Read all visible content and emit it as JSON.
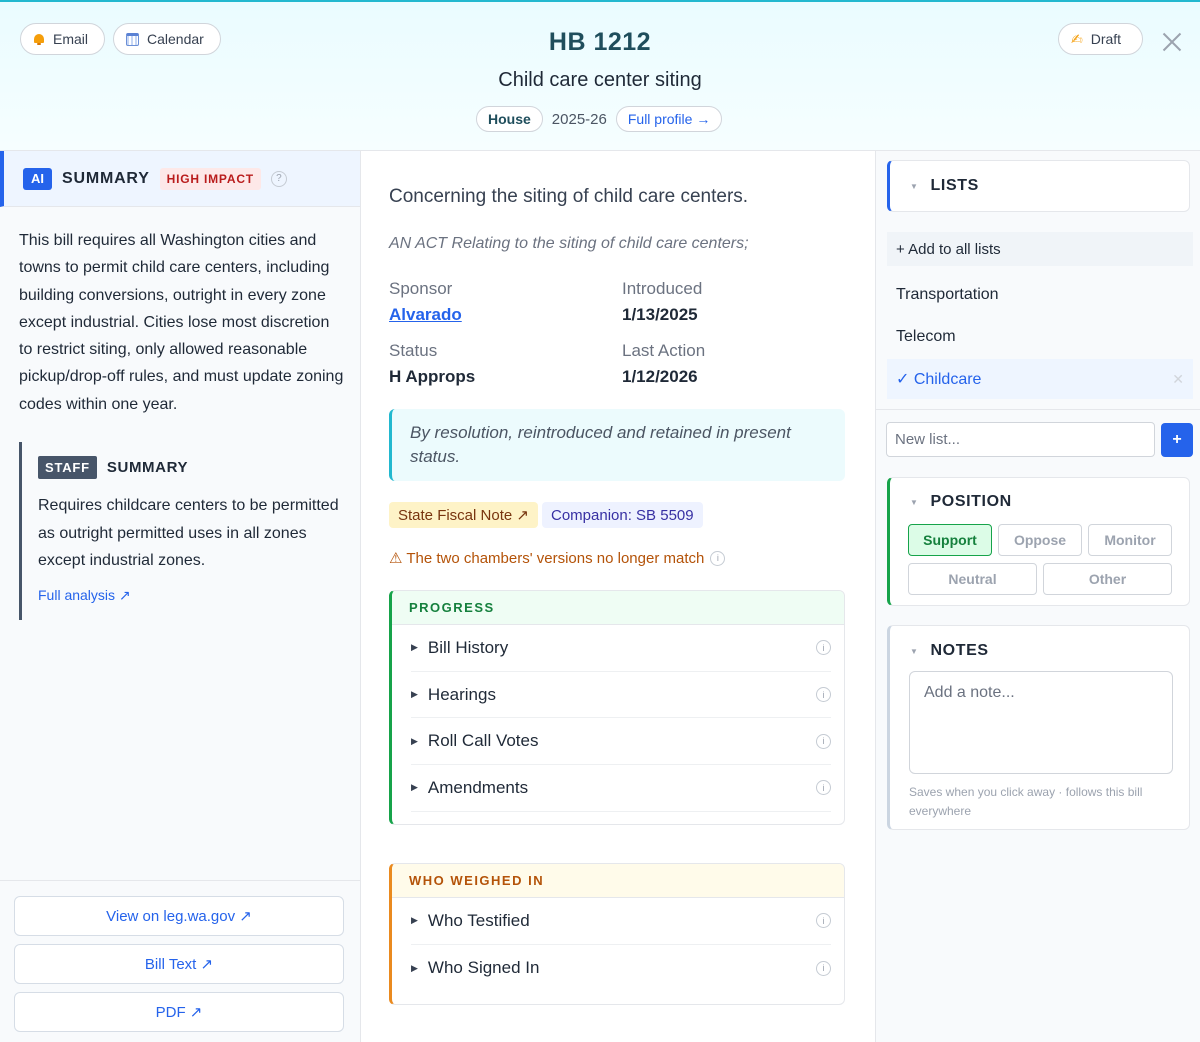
{
  "header": {
    "email_label": "Email",
    "calendar_label": "Calendar",
    "draft_label": "Draft",
    "bill_number": "HB 1212",
    "bill_title": "Child care center siting",
    "chamber": "House",
    "session": "2025-26",
    "profile_link": "Full profile →"
  },
  "summary": {
    "ai_badge": "AI",
    "label": "SUMMARY",
    "impact": "HIGH IMPACT",
    "help": "?",
    "text": "This bill requires all Washington cities and towns to permit child care centers, including building conversions, outright in every zone except industrial. Cities lose most discretion to restrict siting, only allowed reasonable pickup/drop-off rules, and must update zoning codes within one year.",
    "staff_badge": "STAFF",
    "staff_label": "SUMMARY",
    "staff_text": "Requires childcare centers to be permitted as outright permitted uses in all zones except industrial zones.",
    "analysis_link": "Full analysis ↗"
  },
  "footer_links": {
    "leg": "View on leg.wa.gov ↗",
    "bill_text": "Bill Text ↗",
    "pdf": "PDF ↗"
  },
  "detail": {
    "description": "Concerning the siting of child care centers.",
    "act": "AN ACT Relating to the siting of child care centers;",
    "sponsor_label": "Sponsor",
    "sponsor": "Alvarado",
    "introduced_label": "Introduced",
    "introduced": "1/13/2025",
    "status_label": "Status",
    "status": "H Approps",
    "last_action_label": "Last Action",
    "last_action": "1/12/2026",
    "callout": "By resolution, reintroduced and retained in present status.",
    "fiscal_note": "State Fiscal Note ↗",
    "companion": "Companion: SB 5509",
    "warning": "⚠ The two chambers' versions no longer match"
  },
  "progress": {
    "title": "PROGRESS",
    "items": [
      "Bill History",
      "Hearings",
      "Roll Call Votes",
      "Amendments"
    ]
  },
  "weighed": {
    "title": "WHO WEIGHED IN",
    "items": [
      "Who Testified",
      "Who Signed In"
    ]
  },
  "lists": {
    "title": "LISTS",
    "add_all": "+ Add to all lists",
    "items": [
      "Transportation",
      "Telecom",
      "✓ Childcare"
    ],
    "new_placeholder": "New list...",
    "plus": "+"
  },
  "position": {
    "title": "POSITION",
    "options": [
      "Support",
      "Oppose",
      "Monitor",
      "Neutral",
      "Other"
    ],
    "selected": "Support"
  },
  "notes": {
    "title": "NOTES",
    "placeholder": "Add a note...",
    "hint": "Saves when you click away · follows this bill everywhere"
  },
  "colors": {
    "accent": "#2563eb",
    "teal": "#22b8cf",
    "support_green": "#16a34a",
    "impact_red": "#b91c1c",
    "warning_orange": "#b45309"
  }
}
